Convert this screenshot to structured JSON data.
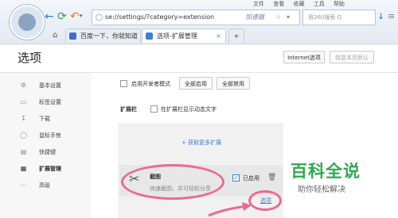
{
  "browser": {
    "menu": [
      "文件",
      "查看",
      "收藏",
      "工具",
      "帮助"
    ],
    "address": "se://settings/?category=extension",
    "address_badge": "加速器",
    "search_placeholder": "用360搜索 Q",
    "tabs": [
      {
        "label": "百度一下，你就知道"
      },
      {
        "label": "选项-扩展管理"
      }
    ],
    "new_tab": "+"
  },
  "page": {
    "title": "选项",
    "internet_options": "Internet选项",
    "restore_defaults": "恢复本页默认"
  },
  "sidebar": {
    "items": [
      {
        "icon": "gear-icon",
        "label": "基本设置"
      },
      {
        "icon": "tab-icon",
        "label": "标签设置"
      },
      {
        "icon": "download-icon",
        "label": "下载"
      },
      {
        "icon": "mouse-icon",
        "label": "鼠标手势"
      },
      {
        "icon": "keyboard-icon",
        "label": "快捷键"
      },
      {
        "icon": "grid-icon",
        "label": "扩展管理"
      },
      {
        "icon": "more-icon",
        "label": "高级"
      }
    ]
  },
  "extensions": {
    "dev_mode_label": "启用开发者模式",
    "enable_all": "全部启用",
    "disable_all": "全部禁用",
    "toolbar_heading": "扩展栏",
    "show_dynamic_text": "在扩展栏显示动态文字",
    "get_more": "+ 获取更多扩展",
    "item": {
      "name": "截图",
      "desc": "快速截图，并可轻松分享",
      "enabled_label": "已启用",
      "options_link": "选项"
    }
  },
  "watermark": {
    "main": "百科全说",
    "sub": "助你轻松解决"
  }
}
